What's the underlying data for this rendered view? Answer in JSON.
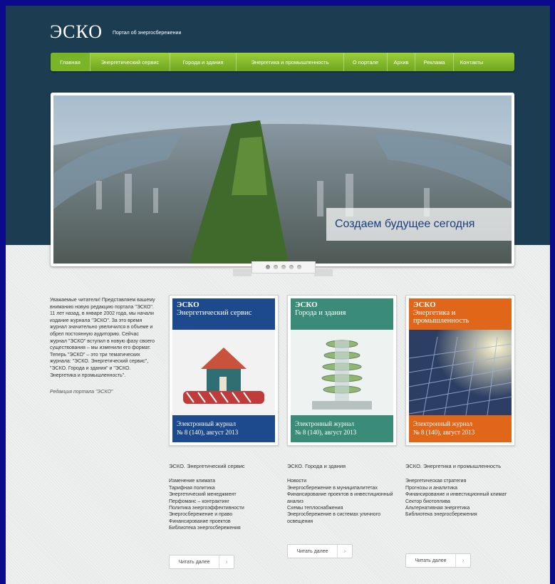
{
  "site": {
    "logo": "ЭСКО",
    "tagline": "Портал об энергосбережении"
  },
  "nav": [
    {
      "label": "Главная",
      "active": true
    },
    {
      "label": "Энергетический сервис"
    },
    {
      "label": "Города и здания"
    },
    {
      "label": "Энергетика и промышленность"
    },
    {
      "label": "О портале"
    },
    {
      "label": "Архив"
    },
    {
      "label": "Реклама"
    },
    {
      "label": "Контакты"
    }
  ],
  "slider": {
    "caption": "Создаем будущее сегодня",
    "dots": 5,
    "active_dot": 1
  },
  "intro": {
    "text": "Уважаемые читатели! Представляем вашему вниманию новую редакцию портала \"ЭСКО\". 11 лет назад, в январе 2002 года, мы начали издание журнала \"ЭСКО\". За это время журнал значительно увеличился в объеме и обрел постоянную аудиторию. Сейчас журнал \"ЭСКО\" вступил в новую фазу своего существования – мы изменили его формат. Теперь \"ЭСКО\" – это три тематических журнала: \"ЭСКО. Энергетический сервис\", \"ЭСКО. Города и здания\" и \"ЭСКО. Энергетика и промышленность\".",
    "signature": "Редакция портала \"ЭСКО\""
  },
  "journals": [
    {
      "brand": "ЭСКО",
      "title": "Энергетический сервис",
      "footer1": "Электронный журнал",
      "footer2": "№ 8 (140), август 2013",
      "color": "#1d4a8c",
      "heading": "ЭСКО. Энергетический сервис",
      "links": [
        "Изменение климата",
        "Тарифная политика",
        "Энергетический менеджмент",
        "Перфоманс – контрактинг",
        "Политика энергоэффективности",
        "Энергосбережение и право",
        "Финансирование проектов",
        "Библиотека энергосбережения"
      ],
      "read_more": "Читать далее"
    },
    {
      "brand": "ЭСКО",
      "title": "Города и здания",
      "footer1": "Электронный журнал",
      "footer2": "№ 8 (140), август 2013",
      "color": "#3a8c78",
      "heading": "ЭСКО. Города и здания",
      "links": [
        "Новости",
        "Энергосбережение в муниципалитетах",
        "Финансирование проектов в инвестиционный анализ",
        "Схемы теплоснабжения",
        "Энергосбережение в системах уличного освещения"
      ],
      "read_more": "Читать далее"
    },
    {
      "brand": "ЭСКО",
      "title": "Энергетика и промышленность",
      "footer1": "Электронный журнал",
      "footer2": "№ 8 (140), август 2013",
      "color": "#e0661a",
      "heading": "ЭСКО. Энергетика и промышленность",
      "links": [
        "Энергетическая стратегия",
        "Прогнозы и аналитика",
        "Финансирование и инвестиционный климат",
        "Сектор биотоплива",
        "Альтернативная энергетика",
        "Библиотека энергосбережения"
      ],
      "read_more": "Читать далее"
    }
  ],
  "read_more_arrow": "›"
}
